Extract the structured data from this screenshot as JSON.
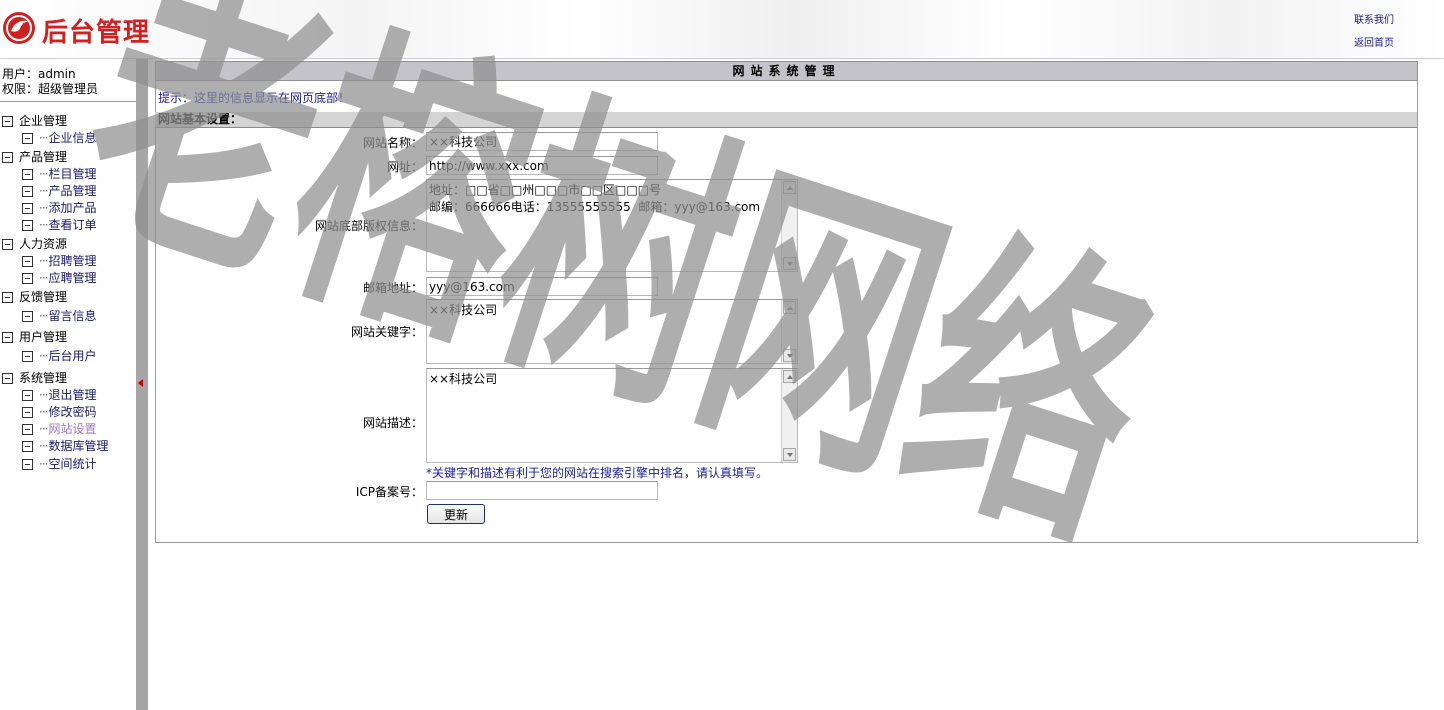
{
  "header": {
    "logo_text": "后台管理",
    "links": {
      "contact": "联系我们",
      "home": "返回首页"
    }
  },
  "user": {
    "user_line": "用户：admin",
    "role_line": "权限：超级管理员"
  },
  "sidebar": {
    "groups": [
      {
        "label": "企业管理",
        "items": [
          "企业信息"
        ]
      },
      {
        "label": "产品管理",
        "items": [
          "栏目管理",
          "产品管理",
          "添加产品",
          "查看订单"
        ]
      },
      {
        "label": "人力资源",
        "items": [
          "招聘管理",
          "应聘管理"
        ]
      },
      {
        "label": "反馈管理",
        "items": [
          "留言信息"
        ]
      },
      {
        "label": "用户管理",
        "items": [
          "后台用户"
        ]
      },
      {
        "label": "系统管理",
        "items": [
          "退出管理",
          "修改密码",
          "网站设置",
          "数据库管理",
          "空间统计"
        ]
      }
    ],
    "active_item": "网站设置"
  },
  "main": {
    "title": "网站系统管理",
    "tip": "提示：这里的信息显示在网页底部！",
    "section": "网站基本设置：",
    "fields": {
      "site_name": {
        "label": "网站名称：",
        "value": "××科技公司"
      },
      "site_url": {
        "label": "网址：",
        "value": "http://www.xxx.com"
      },
      "footer_info": {
        "label": "网站底部版权信息：",
        "value": "地址：□□省□□州□□□市□□区□□□号\n邮编：666666电话：13555555555  邮箱：yyy@163.com"
      },
      "email": {
        "label": "邮箱地址：",
        "value": "yyy@163.com"
      },
      "keywords": {
        "label": "网站关键字：",
        "value": "××科技公司"
      },
      "description": {
        "label": "网站描述：",
        "value": "××科技公司"
      },
      "icp": {
        "label": "ICP备案号：",
        "value": ""
      }
    },
    "hint": "*关键字和描述有利于您的网站在搜索引擎中排名，请认真填写。",
    "submit_label": "更新"
  },
  "watermark": "老榕树网络",
  "colors": {
    "logo_red": "#d21f1f",
    "link_blue": "#1a1a8c",
    "tip_blue": "#1a1aa8",
    "active_item": "#a07ac8",
    "titlebar_bg": "#c4c3c9",
    "splitter_bg": "#a6a6a6"
  },
  "icons": {
    "logo": "bird-logo-icon",
    "tree_toggle": "minus-box-icon",
    "splitter": "collapse-left-arrow-icon",
    "scroll_up": "scroll-up-arrow-icon",
    "scroll_down": "scroll-down-arrow-icon"
  }
}
